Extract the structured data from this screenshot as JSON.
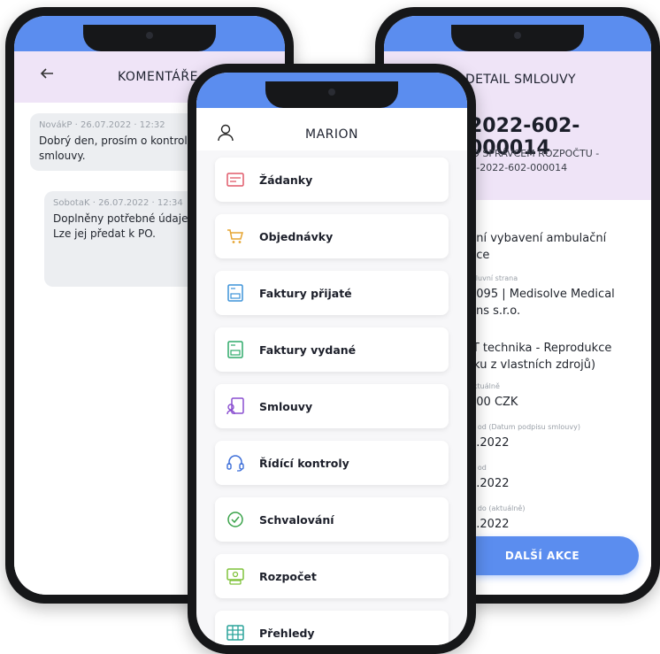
{
  "left_screen": {
    "title": "KOMENTÁŘE",
    "back_icon": "arrow-left-icon",
    "comments": [
      {
        "meta": "NovákP · 26.07.2022 · 12:32",
        "text": "Dobrý den, prosím o kontrol k návrhu smlouvy."
      },
      {
        "meta": "SobotaK · 26.07.2022 · 12:34",
        "text": "Doplněny potřebné údaje, smlouvy. Lze jej předat k PO."
      }
    ]
  },
  "center_screen": {
    "title": "MARION",
    "user_icon": "user-icon",
    "menu": [
      {
        "label": "Žádanky",
        "icon": "requests-icon",
        "color": "#e05a6a"
      },
      {
        "label": "Objednávky",
        "icon": "cart-icon",
        "color": "#e6a532"
      },
      {
        "label": "Faktury přijaté",
        "icon": "invoice-in-icon",
        "color": "#3d93d9"
      },
      {
        "label": "Faktury vydané",
        "icon": "invoice-out-icon",
        "color": "#2eaa6a"
      },
      {
        "label": "Smlouvy",
        "icon": "contract-icon",
        "color": "#8a4fd0"
      },
      {
        "label": "Řídící kontroly",
        "icon": "headset-icon",
        "color": "#3d6fd9"
      },
      {
        "label": "Schvalování",
        "icon": "check-circle-icon",
        "color": "#3aa34a"
      },
      {
        "label": "Rozpočet",
        "icon": "budget-icon",
        "color": "#7fc23a"
      },
      {
        "label": "Přehledy",
        "icon": "table-icon",
        "color": "#2aa39a"
      }
    ]
  },
  "right_screen": {
    "title": "DETAIL SMLOUVY",
    "contract_no": "2022-602-000014",
    "subtitle_line1": "IO SPRÁVCEM ROZPOČTU -",
    "subtitle_line2": "N-2022-602-000014",
    "fields": [
      {
        "label": "",
        "value": "dní vybavení ambulační",
        "value2": "uce"
      },
      {
        "label": "mluvní strana",
        "value": "8095 | Medisolve Medical",
        "value2": "ons s.r.o."
      },
      {
        "label": "",
        "value": "IT technika - Reprodukce",
        "value2": "tku z vlastních zdrojů)"
      },
      {
        "label": "aktuálně",
        "value": "000 CZK",
        "value2": ""
      },
      {
        "label": "st od (Datum podpisu smlouvy)",
        "value": "6.2022",
        "value2": ""
      },
      {
        "label": "st od",
        "value": "6.2022",
        "value2": ""
      },
      {
        "label": "st do (aktuálně)",
        "value": "7.2022",
        "value2": ""
      }
    ],
    "fab_label": "DALŠÍ AKCE"
  }
}
